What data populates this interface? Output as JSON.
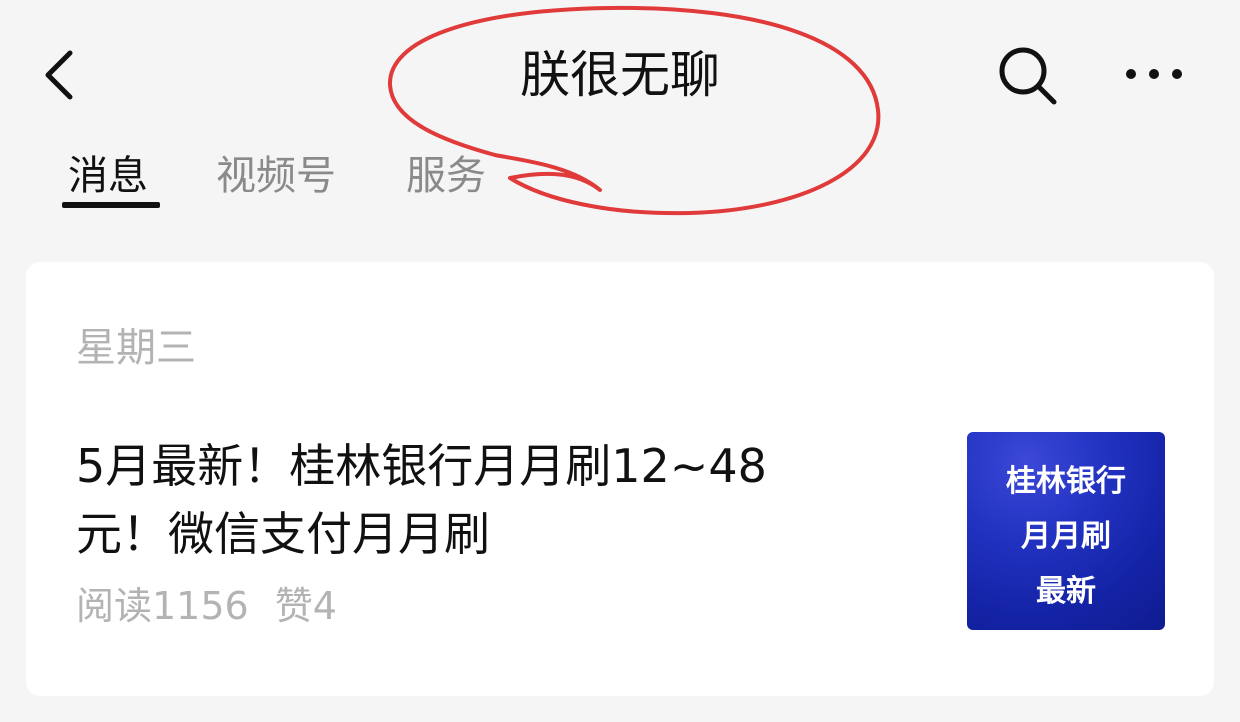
{
  "header": {
    "back_icon": "chevron-left-icon",
    "title": "朕很无聊",
    "search_icon": "search-icon",
    "more_icon": "more-horizontal-icon"
  },
  "tabs": [
    {
      "label": "消息",
      "active": true
    },
    {
      "label": "视频号",
      "active": false
    },
    {
      "label": "服务",
      "active": false
    }
  ],
  "feed": {
    "date": "星期三",
    "article": {
      "title_line1": "5月最新！桂林银行月月刷12~48",
      "title_line2": "元！微信支付月月刷",
      "reads": "阅读1156",
      "likes": "赞4",
      "thumbnail": {
        "line1": "桂林银行",
        "line2": "月月刷",
        "line3": "最新"
      }
    }
  },
  "colors": {
    "background": "#f5f5f5",
    "card": "#ffffff",
    "annotation": "#e03a3a",
    "thumbnail_blue": "#1a2bb5"
  }
}
